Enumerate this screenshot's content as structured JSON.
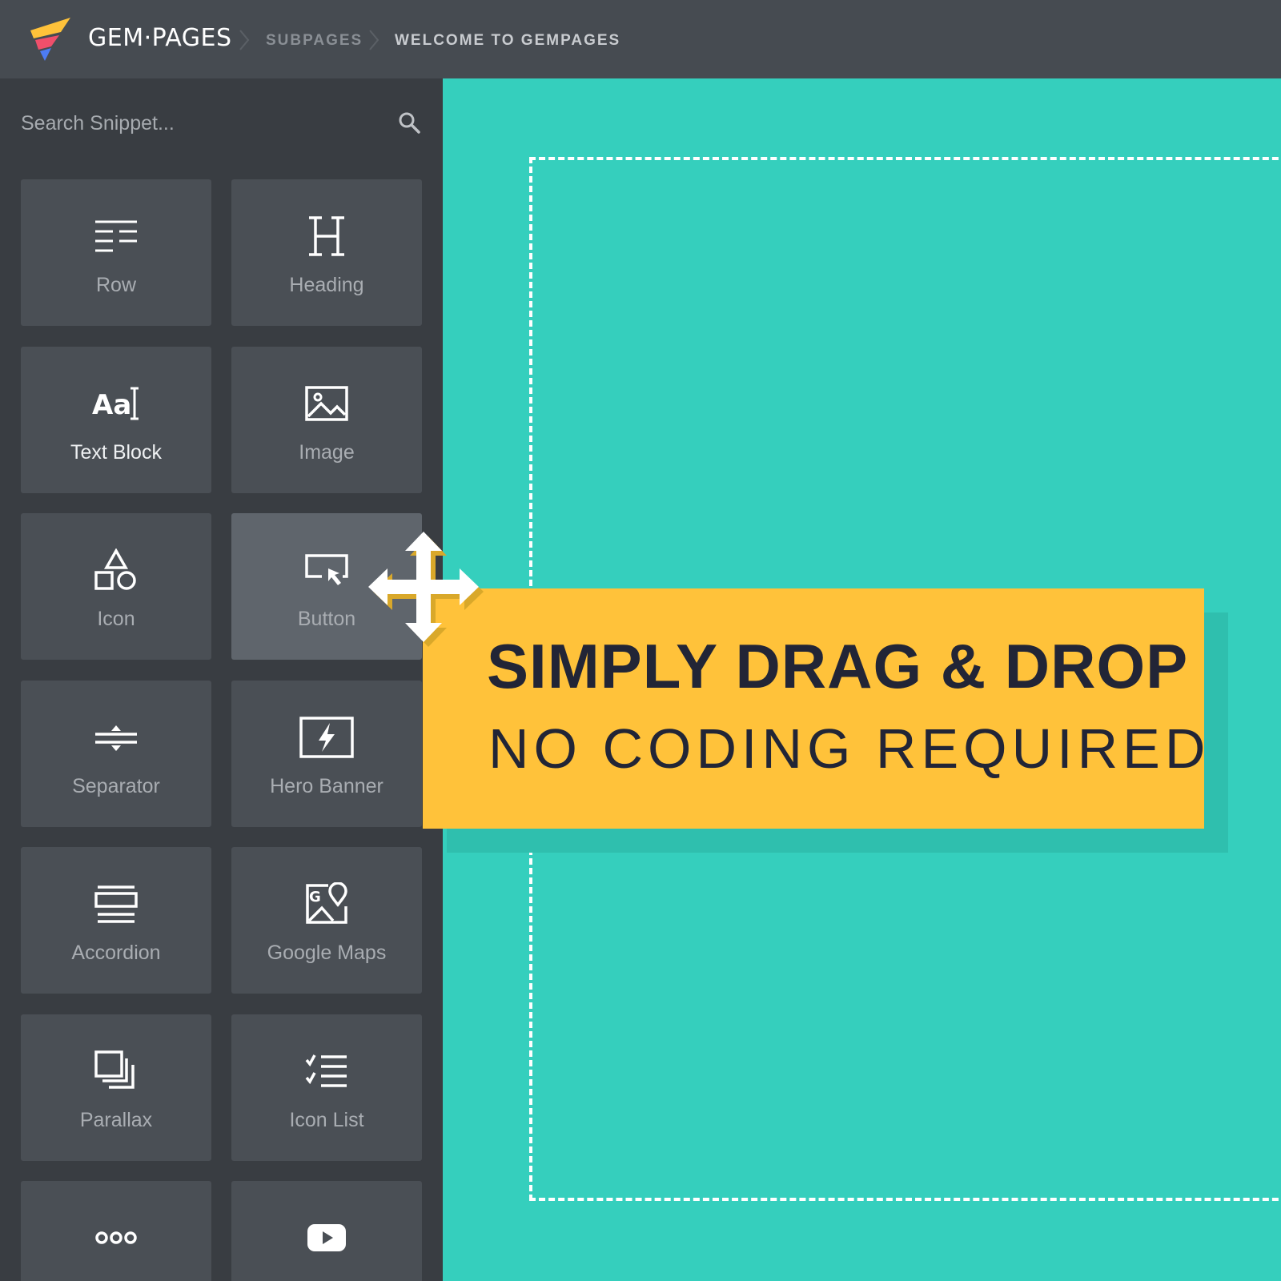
{
  "header": {
    "brand": "GEM·PAGES",
    "breadcrumb": [
      "SUBPAGES",
      "WELCOME TO GEMPAGES"
    ]
  },
  "sidebar": {
    "search_placeholder": "Search Snippet...",
    "items": [
      {
        "label": "Row",
        "icon": "row-icon"
      },
      {
        "label": "Heading",
        "icon": "heading-icon"
      },
      {
        "label": "Text Block",
        "icon": "text-block-icon"
      },
      {
        "label": "Image",
        "icon": "image-icon"
      },
      {
        "label": "Icon",
        "icon": "shapes-icon"
      },
      {
        "label": "Button",
        "icon": "button-icon",
        "active": true
      },
      {
        "label": "Separator",
        "icon": "separator-icon"
      },
      {
        "label": "Hero Banner",
        "icon": "hero-banner-icon"
      },
      {
        "label": "Accordion",
        "icon": "accordion-icon"
      },
      {
        "label": "Google Maps",
        "icon": "google-maps-icon"
      },
      {
        "label": "Parallax",
        "icon": "parallax-icon"
      },
      {
        "label": "Icon List",
        "icon": "icon-list-icon"
      },
      {
        "label": "",
        "icon": "dots-icon"
      },
      {
        "label": "",
        "icon": "youtube-icon"
      }
    ]
  },
  "promo": {
    "title": "SIMPLY DRAG & DROP",
    "subtitle": "NO CODING REQUIRED"
  },
  "colors": {
    "topbar": "#464b51",
    "sidebar": "#393d42",
    "tile": "#4a4f55",
    "canvas": "#35cfbd",
    "accent": "#ffc23a"
  }
}
